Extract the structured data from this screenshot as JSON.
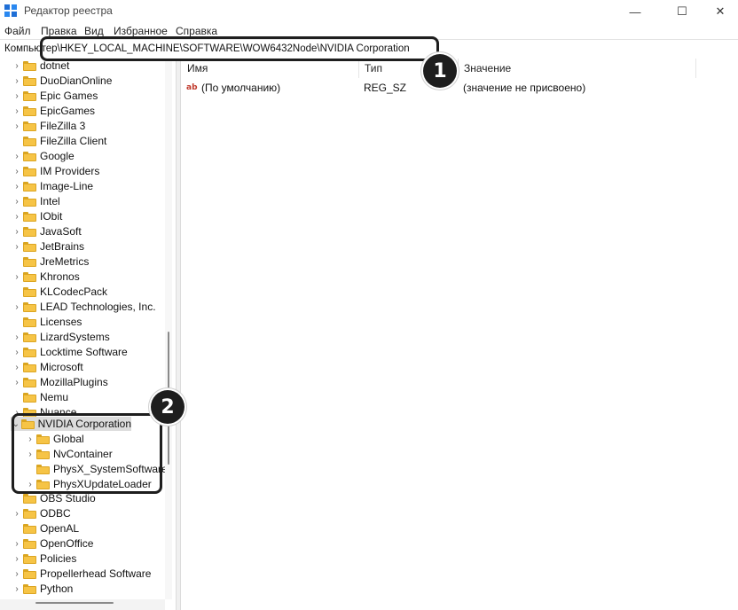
{
  "window": {
    "title": "Редактор реестра",
    "controls": {
      "minimize": "—",
      "maximize": "☐",
      "close": "✕"
    }
  },
  "menu": [
    "Файл",
    "Правка",
    "Вид",
    "Избранное",
    "Справка"
  ],
  "address": "Компьютер\\HKEY_LOCAL_MACHINE\\SOFTWARE\\WOW6432Node\\NVIDIA Corporation",
  "tree": {
    "items": [
      {
        "label": "dotnet",
        "expand": "›"
      },
      {
        "label": "DuoDianOnline",
        "expand": "›"
      },
      {
        "label": "Epic Games",
        "expand": "›"
      },
      {
        "label": "EpicGames",
        "expand": "›"
      },
      {
        "label": "FileZilla 3",
        "expand": "›"
      },
      {
        "label": "FileZilla Client",
        "expand": ""
      },
      {
        "label": "Google",
        "expand": "›"
      },
      {
        "label": "IM Providers",
        "expand": "›"
      },
      {
        "label": "Image-Line",
        "expand": "›"
      },
      {
        "label": "Intel",
        "expand": "›"
      },
      {
        "label": "IObit",
        "expand": "›"
      },
      {
        "label": "JavaSoft",
        "expand": "›"
      },
      {
        "label": "JetBrains",
        "expand": "›"
      },
      {
        "label": "JreMetrics",
        "expand": ""
      },
      {
        "label": "Khronos",
        "expand": "›"
      },
      {
        "label": "KLCodecPack",
        "expand": ""
      },
      {
        "label": "LEAD Technologies, Inc.",
        "expand": "›"
      },
      {
        "label": "Licenses",
        "expand": ""
      },
      {
        "label": "LizardSystems",
        "expand": "›"
      },
      {
        "label": "Locktime Software",
        "expand": "›"
      },
      {
        "label": "Microsoft",
        "expand": "›"
      },
      {
        "label": "MozillaPlugins",
        "expand": "›"
      },
      {
        "label": "Nemu",
        "expand": ""
      },
      {
        "label": "Nuance",
        "expand": "›"
      },
      {
        "label": "NVIDIA Corporation",
        "expand": "⌄",
        "selected": true
      },
      {
        "label": "Global",
        "expand": "›",
        "child": true
      },
      {
        "label": "NvContainer",
        "expand": "›",
        "child": true
      },
      {
        "label": "PhysX_SystemSoftware",
        "expand": "",
        "child": true
      },
      {
        "label": "PhysXUpdateLoader",
        "expand": "›",
        "child": true
      },
      {
        "label": "OBS Studio",
        "expand": ""
      },
      {
        "label": "ODBC",
        "expand": "›"
      },
      {
        "label": "OpenAL",
        "expand": ""
      },
      {
        "label": "OpenOffice",
        "expand": "›"
      },
      {
        "label": "Policies",
        "expand": "›"
      },
      {
        "label": "Propellerhead Software",
        "expand": "›"
      },
      {
        "label": "Python",
        "expand": "›"
      }
    ]
  },
  "list": {
    "columns": [
      "Имя",
      "Тип",
      "Значение"
    ],
    "rows": [
      {
        "icon": "ab",
        "name": "(По умолчанию)",
        "type": "REG_SZ",
        "value": "(значение не присвоено)"
      }
    ]
  },
  "annotations": [
    "1",
    "2"
  ],
  "colors": {
    "annotation": "#1e1e1e",
    "folder": "#f6c446",
    "selection": "#dcdcdc"
  }
}
